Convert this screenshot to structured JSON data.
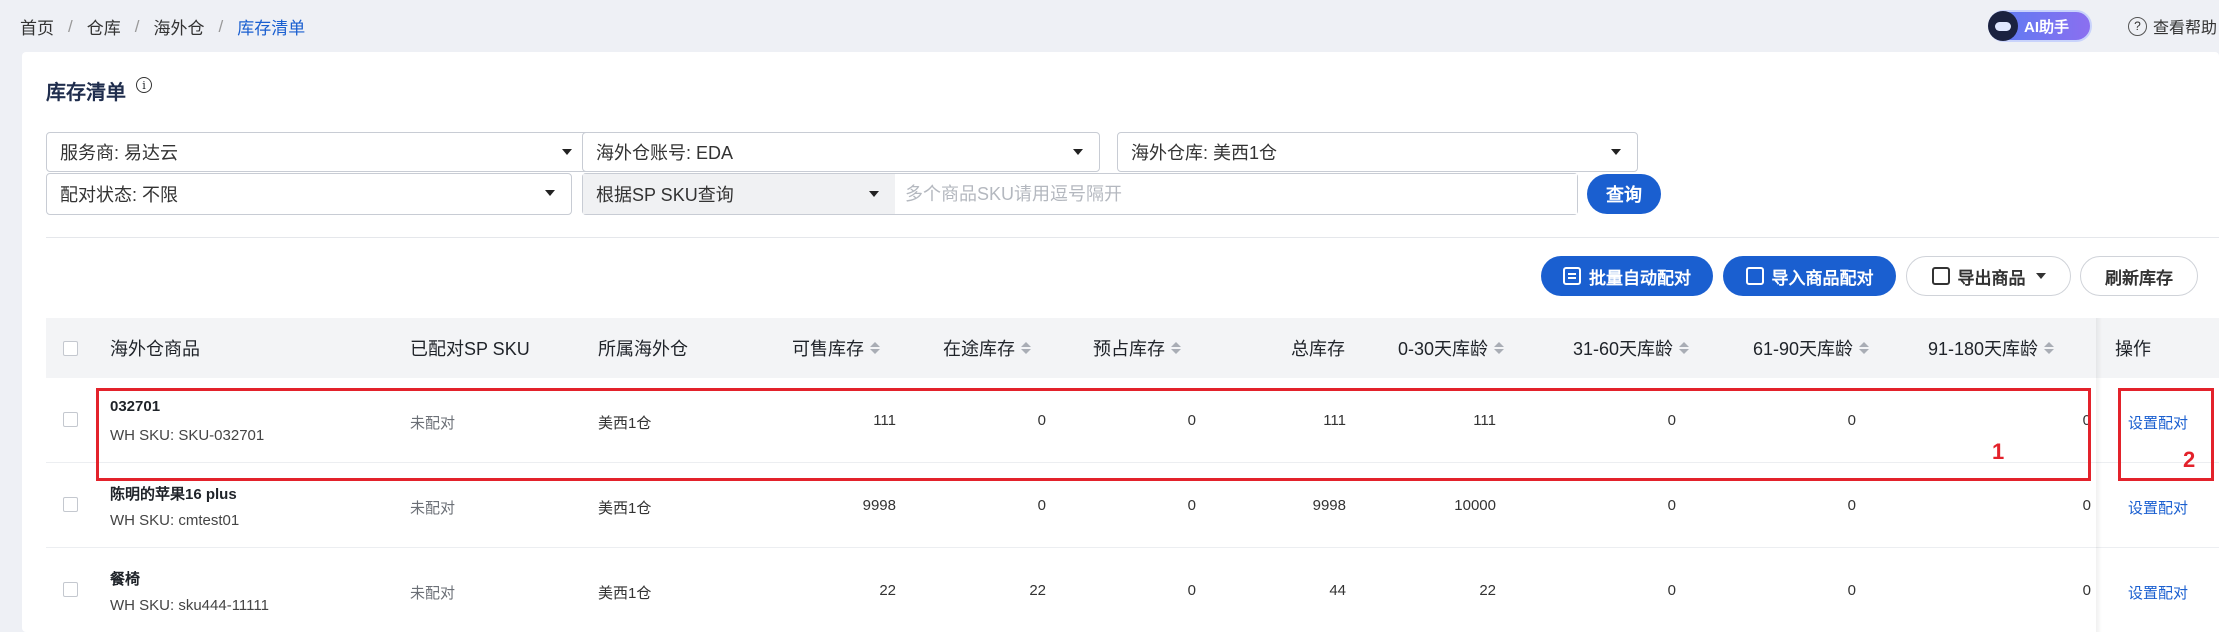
{
  "breadcrumb": [
    "首页",
    "仓库",
    "海外仓",
    "库存清单"
  ],
  "header": {
    "ai_label": "AI助手",
    "help_label": "查看帮助"
  },
  "page": {
    "title": "库存清单",
    "info_glyph": "i"
  },
  "filters": {
    "provider": "服务商: 易达云",
    "account": "海外仓账号: EDA",
    "warehouse": "海外仓库: 美西1仓",
    "match_status": "配对状态: 不限",
    "search_type": "根据SP SKU查询",
    "search_placeholder": "多个商品SKU请用逗号隔开",
    "query_label": "查询"
  },
  "actions": {
    "batch_auto_match": "批量自动配对",
    "import_match": "导入商品配对",
    "export": "导出商品",
    "refresh": "刷新库存"
  },
  "table": {
    "columns": [
      "海外仓商品",
      "已配对SP SKU",
      "所属海外仓",
      "可售库存",
      "在途库存",
      "预占库存",
      "总库存",
      "0-30天库龄",
      "31-60天库龄",
      "61-90天库龄",
      "91-180天库龄",
      "操作"
    ],
    "rows": [
      {
        "name": "032701",
        "sku": "WH SKU: SKU-032701",
        "matched": "未配对",
        "warehouse": "美西1仓",
        "sellable": "111",
        "transit": "0",
        "reserved": "0",
        "total": "111",
        "age_0_30": "111",
        "age_31_60": "0",
        "age_61_90": "0",
        "age_91_180": "0",
        "op": "设置配对"
      },
      {
        "name": "陈明的苹果16 plus",
        "sku": "WH SKU: cmtest01",
        "matched": "未配对",
        "warehouse": "美西1仓",
        "sellable": "9998",
        "transit": "0",
        "reserved": "0",
        "total": "9998",
        "age_0_30": "10000",
        "age_31_60": "0",
        "age_61_90": "0",
        "age_91_180": "0",
        "op": "设置配对"
      },
      {
        "name": "餐椅",
        "sku": "WH SKU: sku444-11111",
        "matched": "未配对",
        "warehouse": "美西1仓",
        "sellable": "22",
        "transit": "22",
        "reserved": "0",
        "total": "44",
        "age_0_30": "22",
        "age_31_60": "0",
        "age_61_90": "0",
        "age_91_180": "0",
        "op": "设置配对"
      }
    ]
  },
  "annotations": {
    "label_1": "1",
    "label_2": "2",
    "color": "#e3222b"
  },
  "colors": {
    "primary": "#1a5fd0",
    "background": "#eef0f5"
  }
}
